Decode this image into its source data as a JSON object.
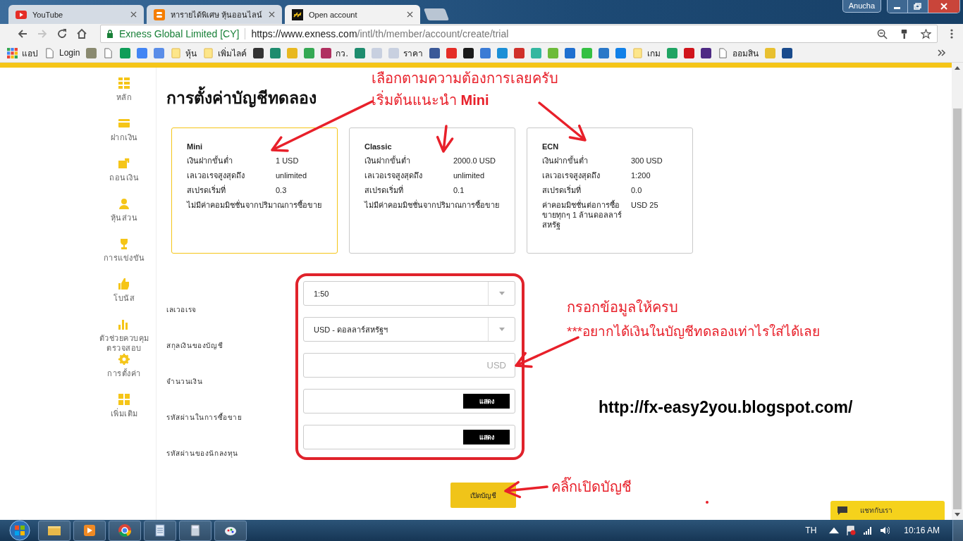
{
  "browser": {
    "tabs": [
      {
        "title": "YouTube",
        "kind": "youtube",
        "selected": false
      },
      {
        "title": "หารายได้พิเศษ หุ้นออนไลน์",
        "kind": "blogger",
        "selected": false
      },
      {
        "title": "Open account",
        "kind": "exness",
        "selected": true
      }
    ],
    "user": "Anucha",
    "forward_enabled": false,
    "address": {
      "site_name": "Exness Global Limited [CY]",
      "url_host": "https://www.exness.com",
      "url_path": "/intl/th/member/account/create/trial"
    },
    "bookmarks": [
      {
        "kind": "apps",
        "label": "แอป"
      },
      {
        "kind": "page",
        "label": "Login"
      },
      {
        "kind": "icon",
        "color": "#8a8a70"
      },
      {
        "kind": "page"
      },
      {
        "kind": "icon",
        "color": "#0f9d58"
      },
      {
        "kind": "icon",
        "color": "#4285f4"
      },
      {
        "kind": "icon",
        "color": "#5a8de8"
      },
      {
        "kind": "folder",
        "label": "หุ้น"
      },
      {
        "kind": "folder",
        "label": "เพิ่มไลค์"
      },
      {
        "kind": "icon",
        "color": "#333333"
      },
      {
        "kind": "icon",
        "color": "#1e8c6e"
      },
      {
        "kind": "icon",
        "color": "#e8b820"
      },
      {
        "kind": "icon",
        "color": "#34a853"
      },
      {
        "kind": "icon",
        "color": "#b03060",
        "label": "กว."
      },
      {
        "kind": "icon",
        "color": "#1e8c6e"
      },
      {
        "kind": "icon",
        "color": "#c8d0e0"
      },
      {
        "kind": "icon",
        "color": "#c8d0e0",
        "label": "ราคา"
      },
      {
        "kind": "icon",
        "color": "#3b5998"
      },
      {
        "kind": "icon",
        "color": "#e52d27"
      },
      {
        "kind": "icon",
        "color": "#1a1a1a"
      },
      {
        "kind": "icon",
        "color": "#3a7bd5"
      },
      {
        "kind": "icon",
        "color": "#1b8fd6"
      },
      {
        "kind": "icon",
        "color": "#d0302a"
      },
      {
        "kind": "icon",
        "color": "#34b7a0"
      },
      {
        "kind": "icon",
        "color": "#6dbb3a"
      },
      {
        "kind": "icon",
        "color": "#1e6fd0"
      },
      {
        "kind": "icon",
        "color": "#35c043"
      },
      {
        "kind": "icon",
        "color": "#2a78c8"
      },
      {
        "kind": "icon",
        "color": "#1281e8"
      },
      {
        "kind": "folder",
        "label": "เกม"
      },
      {
        "kind": "icon",
        "color": "#1fa463"
      },
      {
        "kind": "icon",
        "color": "#d0141b"
      },
      {
        "kind": "icon",
        "color": "#4e2a84"
      },
      {
        "kind": "page",
        "label": "ออมสิน"
      },
      {
        "kind": "icon",
        "color": "#e8c030"
      },
      {
        "kind": "icon",
        "color": "#1a4b8c"
      }
    ]
  },
  "sidebar": {
    "items": [
      {
        "label": "หลัก"
      },
      {
        "label": "ฝากเงิน"
      },
      {
        "label": "ถอนเงิน"
      },
      {
        "label": "หุ้นส่วน"
      },
      {
        "label": "การแข่งขัน"
      },
      {
        "label": "โบนัส"
      },
      {
        "label": "ตัวช่วยควบคุมตรวจสอบ"
      },
      {
        "label": "การตั้งค่า"
      },
      {
        "label": "เพิ่มเติม"
      }
    ]
  },
  "page": {
    "title": "การตั้งค่าบัญชีทดลอง",
    "account_types": [
      {
        "title": "Mini",
        "selected": true,
        "rows": [
          {
            "label": "เงินฝากขั้นต่ำ",
            "value": "1 USD"
          },
          {
            "label": "เลเวอเรจสูงสุดถึง",
            "value": "unlimited"
          },
          {
            "label": "สเปรดเริ่มที่",
            "value": "0.3"
          }
        ],
        "note": "ไม่มีค่าคอมมิชชั่นจากปริมาณการซื้อขาย"
      },
      {
        "title": "Classic",
        "selected": false,
        "rows": [
          {
            "label": "เงินฝากขั้นต่ำ",
            "value": "2000.0 USD"
          },
          {
            "label": "เลเวอเรจสูงสุดถึง",
            "value": "unlimited"
          },
          {
            "label": "สเปรดเริ่มที่",
            "value": "0.1"
          }
        ],
        "note": "ไม่มีค่าคอมมิชชั่นจากปริมาณการซื้อขาย"
      },
      {
        "title": "ECN",
        "selected": false,
        "rows": [
          {
            "label": "เงินฝากขั้นต่ำ",
            "value": "300 USD"
          },
          {
            "label": "เลเวอเรจสูงสุดถึง",
            "value": "1:200"
          },
          {
            "label": "สเปรดเริ่มที่",
            "value": "0.0"
          },
          {
            "label": "ค่าคอมมิชชั่นต่อการซื้อขายทุกๆ 1 ล้านดอลลาร์สหรัฐ",
            "value": "USD 25"
          }
        ]
      }
    ],
    "form": [
      {
        "label": "เลเวอเรจ",
        "kind": "select",
        "value": "1:50"
      },
      {
        "label": "สกุลเงินของบัญชี",
        "kind": "select",
        "value": "USD - ดอลลาร์สหรัฐฯ"
      },
      {
        "label": "จำนวนเงิน",
        "kind": "amount",
        "placeholder": "USD"
      },
      {
        "label": "รหัสผ่านในการซื้อขาย",
        "kind": "password",
        "button": "แสดง"
      },
      {
        "label": "รหัสผ่านของนักลงทุน",
        "kind": "password",
        "button": "แสดง"
      }
    ],
    "submit": "เปิดบัญชี",
    "chat": "แชทกับเรา"
  },
  "annotations": {
    "choose_hint": "เลือกตามความต้องการเลยครับ",
    "recommend_hint": "เริ่มต้นแนะนำ **Mini**",
    "fill_hint": "กรอกข้อมูลให้ครบ",
    "amount_hint": "***อยากได้เงินในบัญชีทดลองเท่าไรใส่ได้เลย",
    "click_hint": "คลิ๊กเปิดบัญชี",
    "blog_url": "http://fx-easy2you.blogspot.com/"
  },
  "taskbar": {
    "language": "TH",
    "clock": "10:16 AM"
  }
}
